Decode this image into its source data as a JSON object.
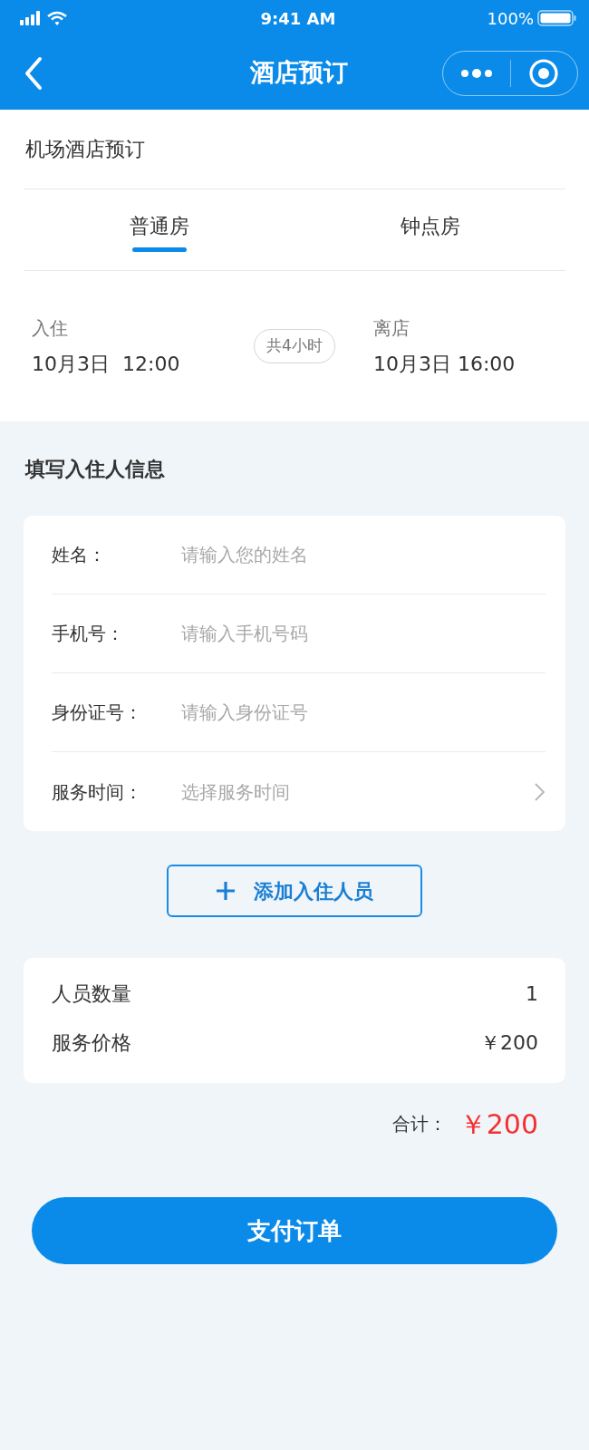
{
  "status_bar": {
    "time": "9:41 AM",
    "battery": "100%"
  },
  "nav_bar": {
    "title": "酒店预订"
  },
  "booking": {
    "title": "机场酒店预订",
    "tabs": [
      {
        "label": "普通房",
        "selected": true
      },
      {
        "label": "钟点房",
        "selected": false
      }
    ],
    "check_in": {
      "label": "入住",
      "date": "10月3日  12:00"
    },
    "duration": "共4小时",
    "check_out": {
      "label": "离店",
      "date": "10月3日 16:00"
    }
  },
  "guest_form": {
    "title": "填写入住人信息",
    "fields": [
      {
        "kind": "input",
        "label": "姓名：",
        "placeholder": "请输入您的姓名"
      },
      {
        "kind": "input",
        "label": "手机号：",
        "placeholder": "请输入手机号码"
      },
      {
        "kind": "input",
        "label": "身份证号：",
        "placeholder": "请输入身份证号"
      },
      {
        "kind": "picker",
        "label": "服务时间：",
        "placeholder": "选择服务时间"
      }
    ]
  },
  "add_guest_button": "添加入住人员",
  "summary": {
    "rows": [
      {
        "label": "人员数量",
        "value": "1"
      },
      {
        "label": "服务价格",
        "value": "￥200"
      }
    ],
    "total_label": "合计：",
    "total_value": "￥200"
  },
  "pay_button": "支付订单"
}
